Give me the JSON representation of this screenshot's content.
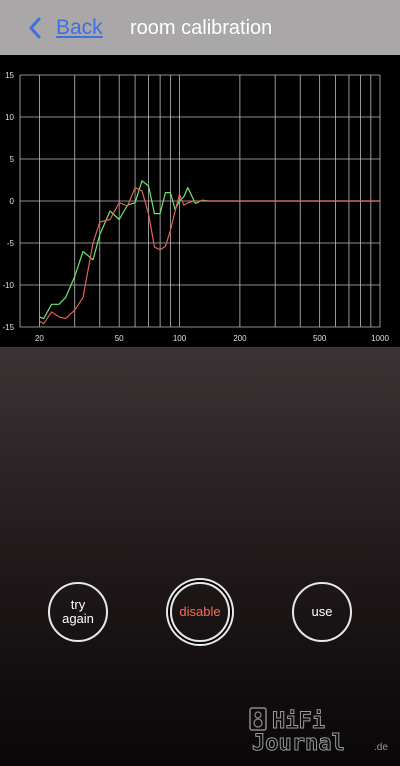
{
  "header": {
    "back_label": "Back",
    "title": "room calibration"
  },
  "chart_data": {
    "type": "line",
    "x_scale": "log",
    "xlim": [
      16,
      1000
    ],
    "ylim": [
      -15,
      15
    ],
    "grid": true,
    "x_tick_labels": [
      "20",
      "50",
      "100",
      "200",
      "500",
      "1000"
    ],
    "y_tick_labels": [
      "15",
      "10",
      "5",
      "0",
      "-5",
      "-10",
      "-15"
    ],
    "series": [
      {
        "color": "#6ee66e",
        "x": [
          20,
          21,
          23,
          25,
          27,
          30,
          33,
          37,
          40,
          45,
          50,
          55,
          60,
          65,
          70,
          75,
          80,
          85,
          90,
          95,
          100,
          105,
          110,
          120,
          130,
          140,
          150,
          170,
          200,
          250,
          300,
          400,
          500,
          700,
          1000
        ],
        "y": [
          -13.8,
          -14,
          -12.3,
          -12.3,
          -11.5,
          -9,
          -6,
          -7,
          -4,
          -1.2,
          -2.2,
          -0.5,
          -0.2,
          2.4,
          1.8,
          -1.5,
          -1.5,
          1,
          1,
          -1,
          0,
          0.5,
          1.6,
          -0.3,
          0.1,
          0,
          0,
          0,
          0,
          0,
          0,
          0,
          0,
          0,
          0
        ]
      },
      {
        "color": "#e0625a",
        "x": [
          20,
          21,
          23,
          25,
          27,
          30,
          33,
          37,
          40,
          45,
          50,
          55,
          60,
          65,
          70,
          75,
          80,
          85,
          90,
          95,
          100,
          105,
          110,
          120,
          130,
          140,
          150,
          170,
          200,
          250,
          300,
          400,
          500,
          700,
          1000
        ],
        "y": [
          -14.3,
          -14.6,
          -13.2,
          -13.8,
          -14,
          -13,
          -11.5,
          -5,
          -2.5,
          -2.2,
          -0.2,
          -0.6,
          1.6,
          1.2,
          -1.5,
          -5.5,
          -5.8,
          -5.4,
          -3.5,
          -1.2,
          0.8,
          -0.5,
          -0.2,
          0,
          0,
          0,
          0,
          0,
          0,
          0,
          0,
          0,
          0,
          0,
          0
        ]
      }
    ]
  },
  "buttons": {
    "try_again": "try\nagain",
    "disable": "disable",
    "use": "use"
  },
  "watermark": {
    "line1": "HiFi",
    "line2": "Journal",
    "suffix": ".de"
  },
  "colors": {
    "header_bg": "#a9a7a8",
    "link": "#3f6fe0",
    "disable_text": "#ff6a5a",
    "grid": "#bdbdbd"
  }
}
